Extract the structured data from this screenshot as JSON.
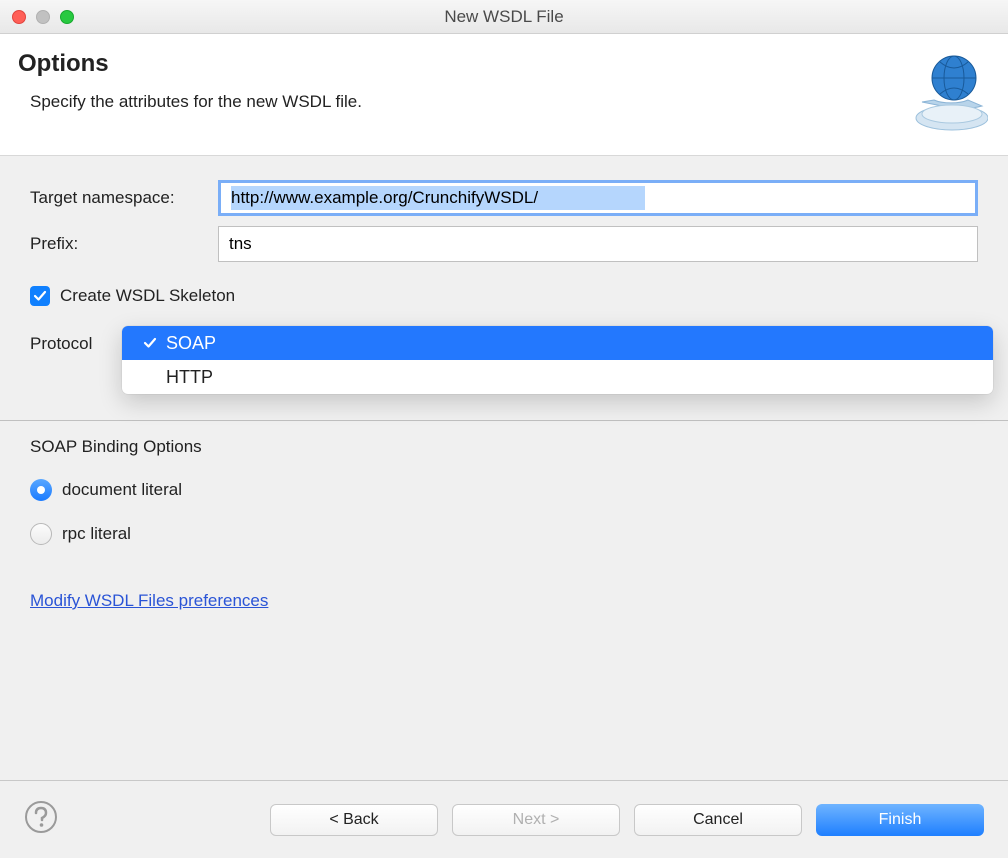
{
  "window": {
    "title": "New WSDL File"
  },
  "header": {
    "title": "Options",
    "subtitle": "Specify the attributes for the new WSDL file."
  },
  "form": {
    "targetNamespace": {
      "label": "Target namespace:",
      "value": "http://www.example.org/CrunchifyWSDL/"
    },
    "prefix": {
      "label": "Prefix:",
      "value": "tns"
    },
    "createSkeleton": {
      "checked": true,
      "label": "Create WSDL Skeleton"
    },
    "protocol": {
      "label": "Protocol",
      "options": [
        "SOAP",
        "HTTP"
      ],
      "selected": "SOAP"
    }
  },
  "soapBinding": {
    "title": "SOAP Binding Options",
    "options": {
      "doc": {
        "label": "document literal",
        "checked": true
      },
      "rpc": {
        "label": "rpc literal",
        "checked": false
      }
    }
  },
  "link": {
    "text": "Modify WSDL Files preferences"
  },
  "footer": {
    "back": "< Back",
    "next": "Next >",
    "cancel": "Cancel",
    "finish": "Finish"
  }
}
